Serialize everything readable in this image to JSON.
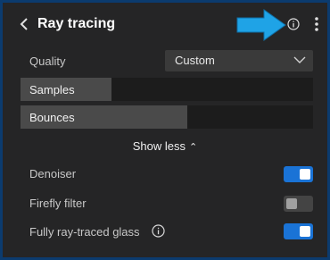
{
  "header": {
    "title": "Ray tracing",
    "back_icon": "chevron-left-icon",
    "info_icon": "info-circle-icon",
    "menu_icon": "kebab-menu-icon",
    "annotation_arrow_color": "#1fa3e6"
  },
  "quality": {
    "label": "Quality",
    "value": "Custom"
  },
  "sliders": [
    {
      "label": "Samples",
      "fraction": 0.31
    },
    {
      "label": "Bounces",
      "fraction": 0.57
    }
  ],
  "show_less": {
    "label": "Show less",
    "caret": "⌃"
  },
  "toggles": [
    {
      "label": "Denoiser",
      "on": true
    },
    {
      "label": "Firefly filter",
      "on": false
    },
    {
      "label": "Fully ray-traced glass",
      "on": true
    }
  ],
  "colors": {
    "accent": "#1a73d6",
    "background": "#252526",
    "border": "#0b3b6e"
  }
}
